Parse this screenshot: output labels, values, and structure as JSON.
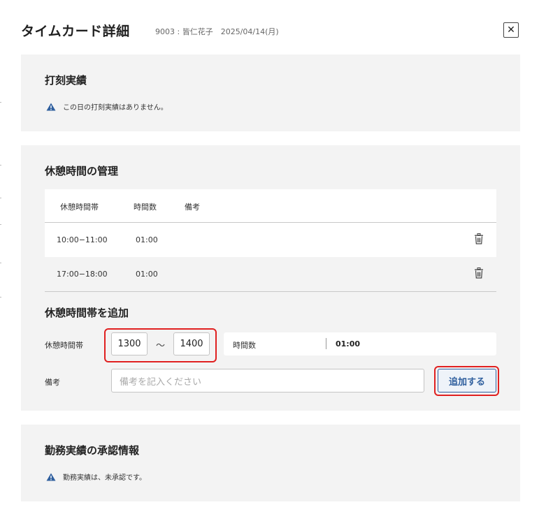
{
  "header": {
    "title": "タイムカード詳細",
    "meta": "9003 : 皆仁花子　2025/04/14(月)",
    "close_glyph": "✕"
  },
  "punch_section": {
    "title": "打刻実績",
    "notice": "この日の打刻実績はありません。"
  },
  "break_section": {
    "title": "休憩時間の管理",
    "columns": [
      "休憩時間帯",
      "時間数",
      "備考"
    ],
    "rows": [
      {
        "range": "10:00−11:00",
        "hours": "01:00",
        "note": ""
      },
      {
        "range": "17:00−18:00",
        "hours": "01:00",
        "note": ""
      }
    ],
    "add_title": "休憩時間帯を追加",
    "range_label": "休憩時間帯",
    "start_value": "1300",
    "separator": "〜",
    "end_value": "1400",
    "hours_label": "時間数",
    "hours_value": "01:00",
    "note_label": "備考",
    "note_placeholder": "備考を記入ください",
    "add_button": "追加する"
  },
  "approval_section": {
    "title": "勤務実績の承認情報",
    "notice": "勤務実績は、未承認です。"
  },
  "colors": {
    "section_bg": "#f3f3f3",
    "accent": "#2f5f9e",
    "warning_icon": "#2f5f9e",
    "highlight": "#e02020"
  }
}
